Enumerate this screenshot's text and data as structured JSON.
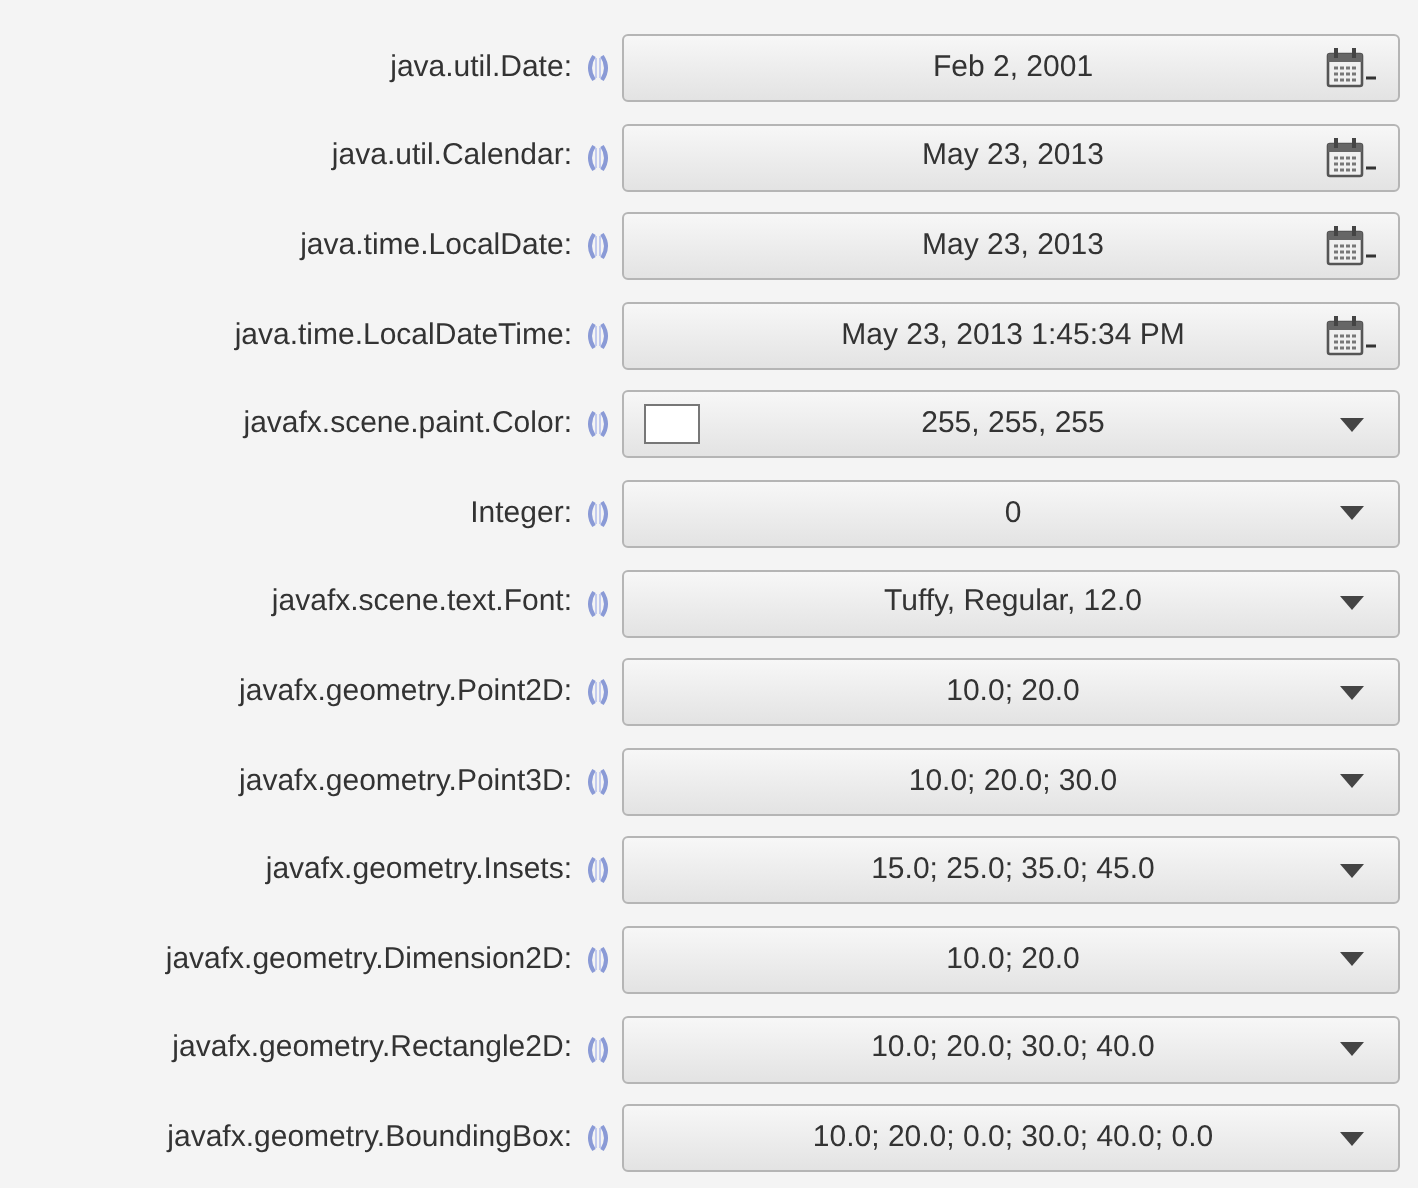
{
  "rows": [
    {
      "label": "java.util.Date:",
      "kind": "date",
      "value": "Feb 2, 2001"
    },
    {
      "label": "java.util.Calendar:",
      "kind": "date",
      "value": "May 23, 2013"
    },
    {
      "label": "java.time.LocalDate:",
      "kind": "date",
      "value": "May 23, 2013"
    },
    {
      "label": "java.time.LocalDateTime:",
      "kind": "date",
      "value": "May 23, 2013 1:45:34 PM"
    },
    {
      "label": "javafx.scene.paint.Color:",
      "kind": "color",
      "value": "255, 255, 255",
      "color": "#ffffff"
    },
    {
      "label": "Integer:",
      "kind": "combo",
      "value": "0"
    },
    {
      "label": "javafx.scene.text.Font:",
      "kind": "combo",
      "value": "Tuffy, Regular, 12.0"
    },
    {
      "label": "javafx.geometry.Point2D:",
      "kind": "combo",
      "value": "10.0; 20.0"
    },
    {
      "label": "javafx.geometry.Point3D:",
      "kind": "combo",
      "value": "10.0; 20.0; 30.0"
    },
    {
      "label": "javafx.geometry.Insets:",
      "kind": "combo",
      "value": "15.0; 25.0; 35.0; 45.0"
    },
    {
      "label": "javafx.geometry.Dimension2D:",
      "kind": "combo",
      "value": "10.0; 20.0"
    },
    {
      "label": "javafx.geometry.Rectangle2D:",
      "kind": "combo",
      "value": "10.0; 20.0; 30.0; 40.0"
    },
    {
      "label": "javafx.geometry.BoundingBox:",
      "kind": "combo",
      "value": "10.0; 20.0; 0.0; 30.0; 40.0; 0.0"
    }
  ]
}
